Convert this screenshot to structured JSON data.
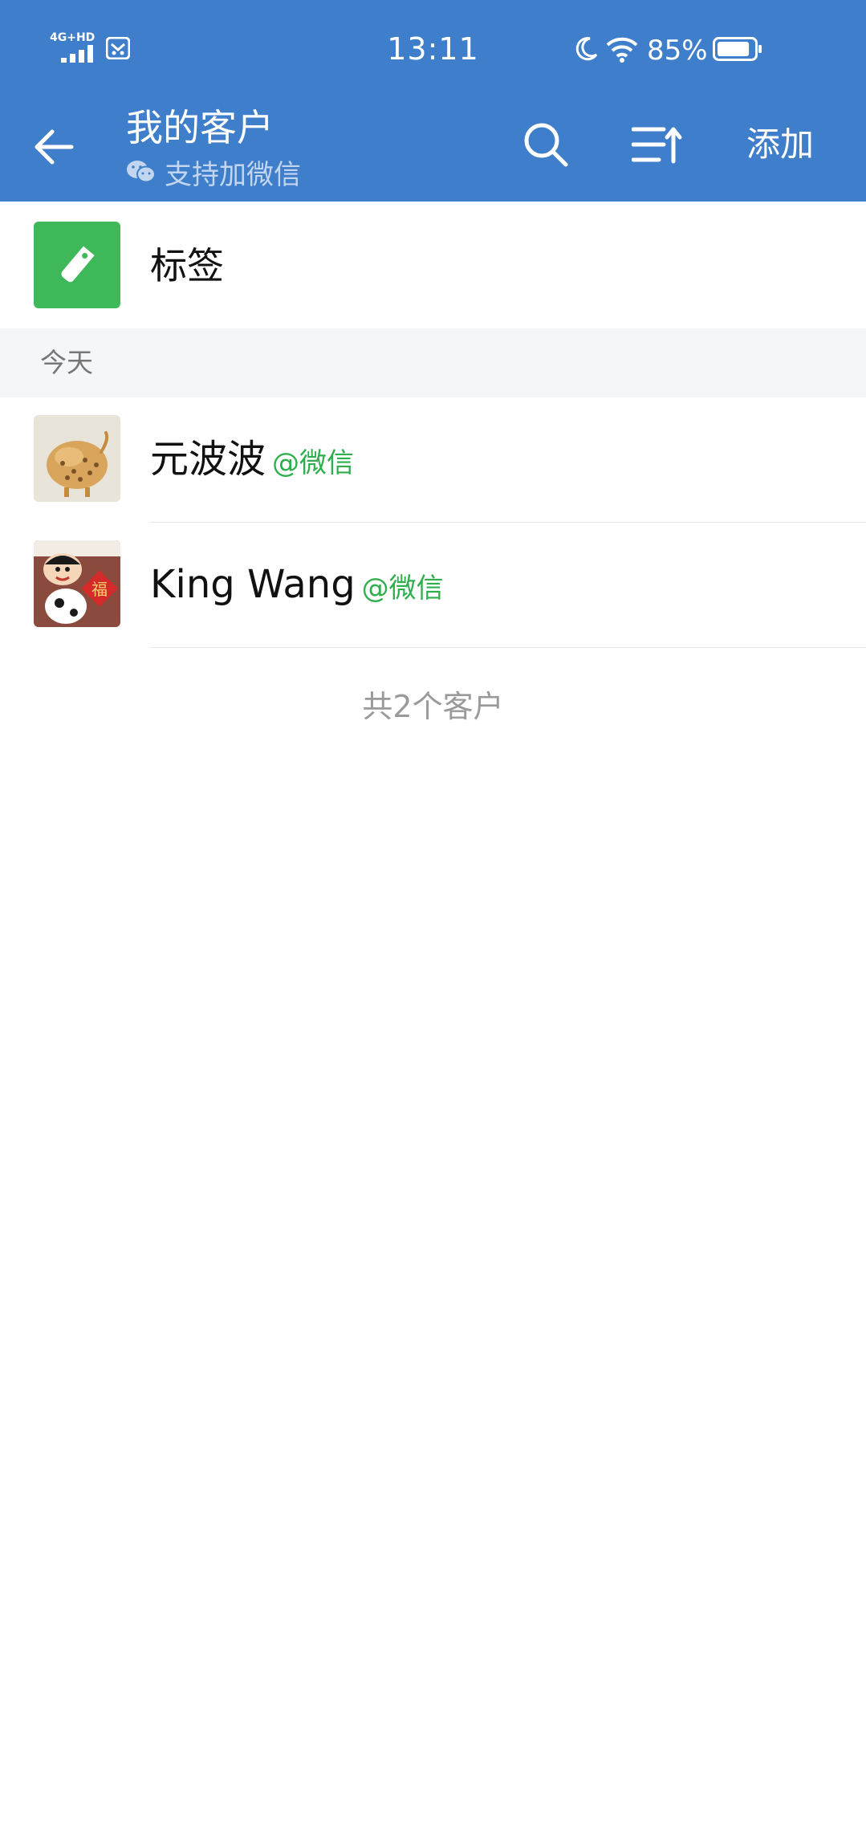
{
  "status_bar": {
    "network": "4G+HD",
    "time": "13:11",
    "battery_percent": "85%",
    "battery_level": 0.85
  },
  "header": {
    "title": "我的客户",
    "subtitle": "支持加微信",
    "add_label": "添加"
  },
  "tag_row": {
    "label": "标签"
  },
  "section": {
    "label": "今天"
  },
  "customers": [
    {
      "name": "元波波",
      "source": "@微信"
    },
    {
      "name": "King Wang",
      "source": "@微信"
    }
  ],
  "footer": {
    "total_text": "共2个客户"
  },
  "colors": {
    "header_bg": "#3f7ecb",
    "tag_green": "#3fb85a",
    "source_green": "#2fae4d",
    "section_bg": "#f5f6f8"
  }
}
